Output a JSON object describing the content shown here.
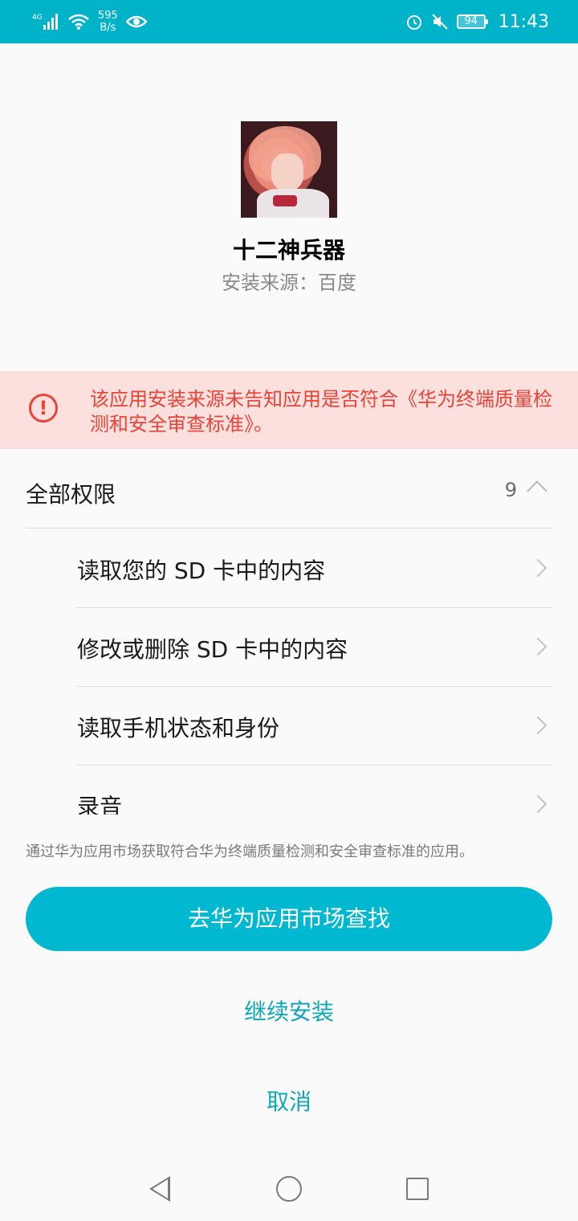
{
  "status_bar": {
    "network": "4G",
    "speed_value": "595",
    "speed_unit": "B/s",
    "battery": "94",
    "time": "11:43"
  },
  "app": {
    "name": "十二神兵器",
    "source": "安装来源：百度"
  },
  "warning": {
    "text": "该应用安装来源未告知应用是否符合《华为终端质量检测和安全审查标准》。"
  },
  "permissions": {
    "title": "全部权限",
    "count": "9",
    "items": [
      {
        "label": "读取您的 SD 卡中的内容"
      },
      {
        "label": "修改或删除 SD 卡中的内容"
      },
      {
        "label": "读取手机状态和身份"
      },
      {
        "label": "录音"
      }
    ]
  },
  "market_note": "通过华为应用市场获取符合华为终端质量检测和安全审查标准的应用。",
  "buttons": {
    "market": "去华为应用市场查找",
    "continue": "继续安装",
    "cancel": "取消"
  },
  "colors": {
    "status_bar": "#00b3c9",
    "primary": "#00b9d1",
    "link": "#0fa6b8",
    "warning_text": "#e94438",
    "warning_bg": "#fbe0dd"
  },
  "icons": [
    "signal-icon",
    "wifi-icon",
    "eye-icon",
    "alarm-icon",
    "mute-icon",
    "battery-icon",
    "alert-icon",
    "chevron-up-icon",
    "chevron-right-icon",
    "nav-back-icon",
    "nav-home-icon",
    "nav-recent-icon"
  ]
}
